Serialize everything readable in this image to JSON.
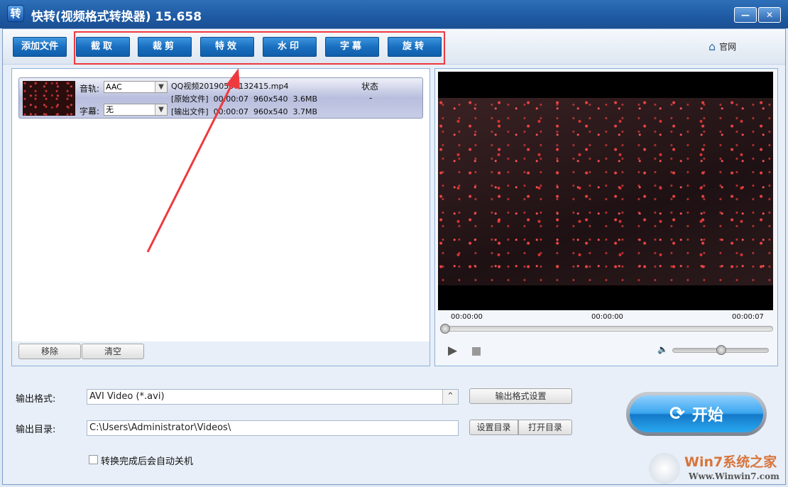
{
  "window": {
    "title": "快转(视频格式转换器) 15.658",
    "icon_text": "转",
    "minimize": "—",
    "close": "✕"
  },
  "toolbar": {
    "add_file": "添加文件",
    "buttons": [
      "截取",
      "裁剪",
      "特效",
      "水印",
      "字幕",
      "旋转"
    ],
    "home_label": "官网"
  },
  "file_list": {
    "items": [
      {
        "audio_label": "音轨:",
        "audio_value": "AAC",
        "subtitle_label": "字幕:",
        "subtitle_value": "无",
        "filename": "QQ视频20190507132415.mp4",
        "original": "[原始文件]  00:00:07  960x540  3.6MB",
        "output": "[输出文件]  00:00:07  960x540  3.7MB",
        "status_header": "状态",
        "status": "-"
      }
    ],
    "remove": "移除",
    "clear": "清空"
  },
  "player": {
    "time_start": "00:00:00",
    "time_current": "00:00:00",
    "time_end": "00:00:07",
    "seek_fraction": 0,
    "volume_fraction": 0.5
  },
  "output": {
    "format_label": "输出格式:",
    "format_value": "AVI Video (*.avi)",
    "format_settings": "输出格式设置",
    "dir_label": "输出目录:",
    "dir_value": "C:\\Users\\Administrator\\Videos\\",
    "set_dir": "设置目录",
    "open_dir": "打开目录",
    "shutdown_label": "转换完成后会自动关机",
    "shutdown_checked": false
  },
  "start": {
    "label": "开始"
  },
  "watermark": {
    "brand": "Win7系统之家",
    "url": "Www.Winwin7.com"
  }
}
